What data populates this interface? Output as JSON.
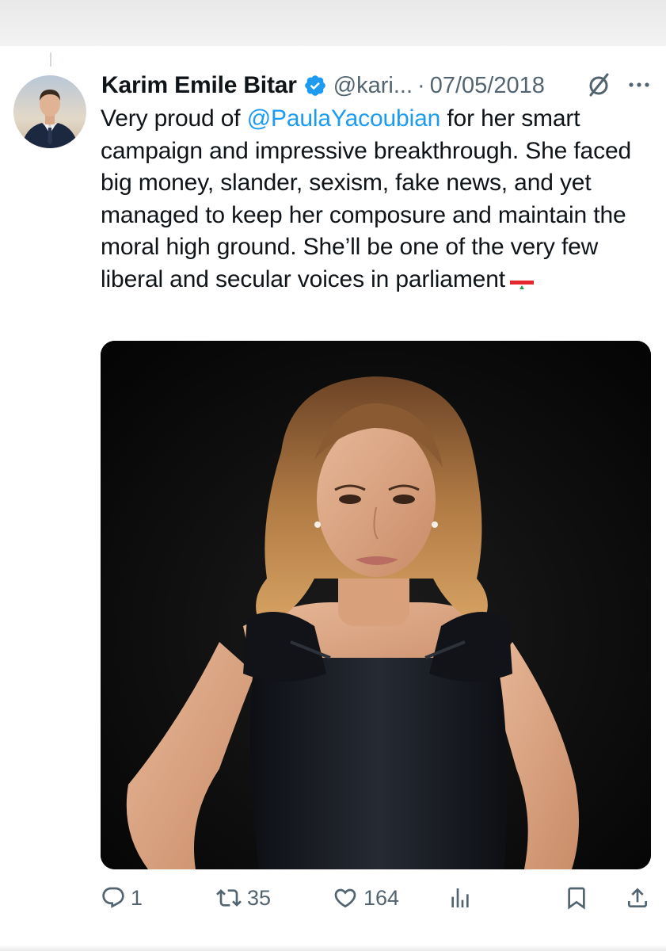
{
  "tweet": {
    "author_name": "Karim Emile Bitar",
    "handle": "@kari...",
    "separator": "·",
    "date": "07/05/2018",
    "text_before_mention": "Very proud of ",
    "mention": "@PaulaYacoubian",
    "text_after_mention": " for her smart campaign and impressive breakthrough. She faced big money, slander, sexism, fake news, and yet managed to keep her composure and maintain the moral high ground. She’ll be one of the very few liberal and secular voices in parliament",
    "flag_icon": "lebanon-flag-emoji",
    "verified_icon": "verified-badge-icon",
    "colors": {
      "mention": "#1d9bf0",
      "verified": "#1d9bf0",
      "secondary_text": "#536471"
    }
  },
  "actions": {
    "replies": "1",
    "reposts": "35",
    "likes": "164",
    "views": "",
    "icons": [
      "reply-icon",
      "repost-icon",
      "like-icon",
      "views-icon",
      "bookmark-icon",
      "share-icon"
    ]
  }
}
